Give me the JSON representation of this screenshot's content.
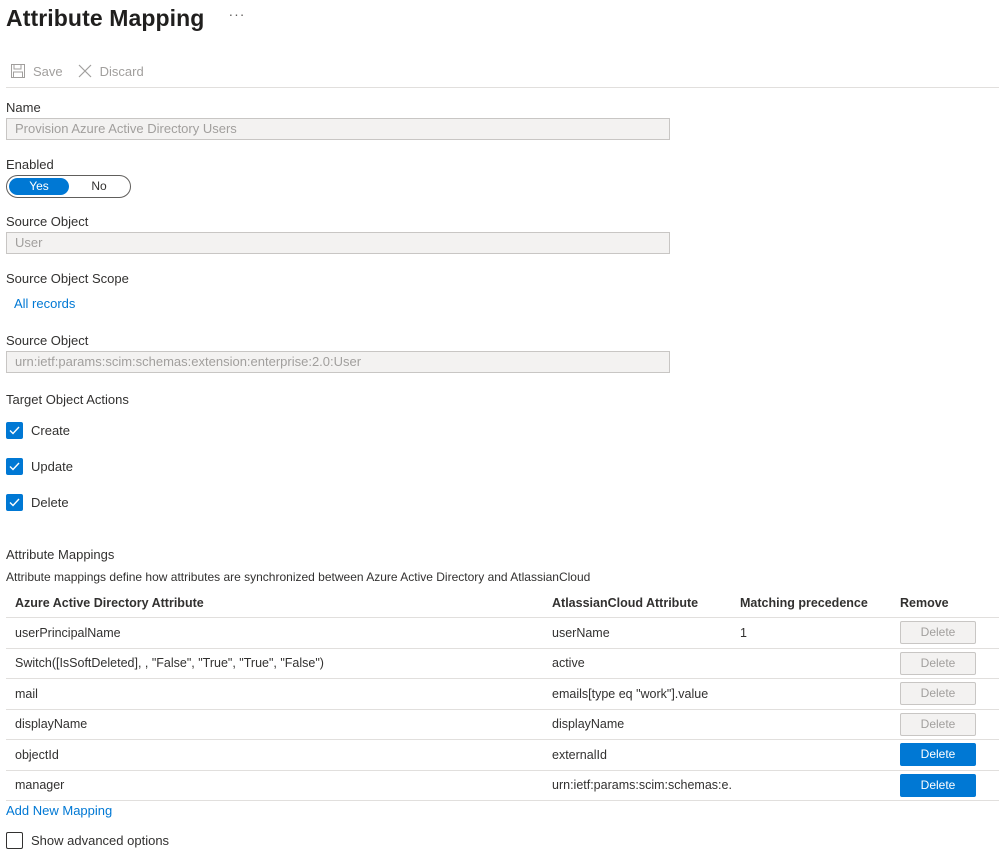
{
  "header": {
    "title": "Attribute Mapping",
    "more": "···"
  },
  "toolbar": {
    "save_label": "Save",
    "discard_label": "Discard"
  },
  "form": {
    "name_label": "Name",
    "name_value": "Provision Azure Active Directory Users",
    "enabled_label": "Enabled",
    "enabled_yes": "Yes",
    "enabled_no": "No",
    "source_object_label": "Source Object",
    "source_object_value": "User",
    "scope_label": "Source Object Scope",
    "scope_link": "All records",
    "source_object2_label": "Source Object",
    "source_object2_value": "urn:ietf:params:scim:schemas:extension:enterprise:2.0:User",
    "target_actions_label": "Target Object Actions",
    "actions": [
      {
        "label": "Create",
        "checked": true
      },
      {
        "label": "Update",
        "checked": true
      },
      {
        "label": "Delete",
        "checked": true
      }
    ]
  },
  "mappings": {
    "title": "Attribute Mappings",
    "description": "Attribute mappings define how attributes are synchronized between Azure Active Directory and AtlassianCloud",
    "columns": [
      "Azure Active Directory Attribute",
      "AtlassianCloud Attribute",
      "Matching precedence",
      "Remove"
    ],
    "delete_label": "Delete",
    "rows": [
      {
        "source": "userPrincipalName",
        "target": "userName",
        "precedence": "1",
        "delete_enabled": false
      },
      {
        "source": "Switch([IsSoftDeleted], , \"False\", \"True\", \"True\", \"False\")",
        "target": "active",
        "precedence": "",
        "delete_enabled": false
      },
      {
        "source": "mail",
        "target": "emails[type eq \"work\"].value",
        "precedence": "",
        "delete_enabled": false
      },
      {
        "source": "displayName",
        "target": "displayName",
        "precedence": "",
        "delete_enabled": false
      },
      {
        "source": "objectId",
        "target": "externalId",
        "precedence": "",
        "delete_enabled": true
      },
      {
        "source": "manager",
        "target": "urn:ietf:params:scim:schemas:e...",
        "precedence": "",
        "delete_enabled": true
      }
    ],
    "add_link": "Add New Mapping",
    "advanced_label": "Show advanced options"
  },
  "colors": {
    "accent": "#0078d4",
    "text": "#323130",
    "disabled": "#a19f9d"
  }
}
